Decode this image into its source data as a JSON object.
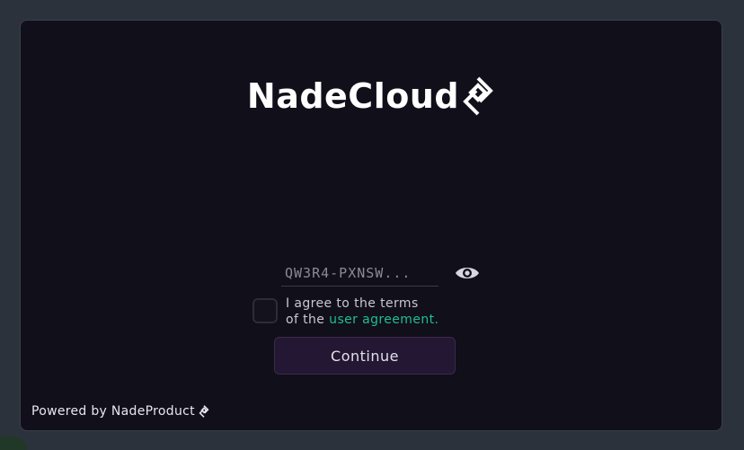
{
  "brand": {
    "name": "NadeCloud",
    "logo_icon": "nade-diamond-logo-icon"
  },
  "license": {
    "key_value": "QW3R4-PXNSW...",
    "toggle_icon": "eye-icon"
  },
  "agreement": {
    "checked": false,
    "text_line1": "I agree to the terms",
    "text_line2_prefix": "of the ",
    "link_text": "user agreement",
    "text_suffix": "."
  },
  "actions": {
    "continue_label": "Continue"
  },
  "footer": {
    "powered_by": "Powered by NadeProduct",
    "icon": "nade-diamond-small-icon"
  },
  "colors": {
    "background": "#2c323c",
    "dialog": "#110f1a",
    "accent_link": "#1fbf8f",
    "button": "#231733"
  }
}
